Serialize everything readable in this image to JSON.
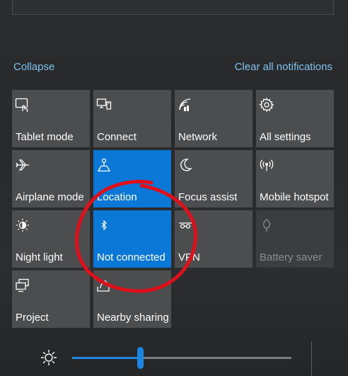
{
  "header": {
    "collapse_label": "Collapse",
    "clear_label": "Clear all notifications"
  },
  "tiles": [
    {
      "label": "Tablet mode",
      "icon": "tablet-mode-icon",
      "state": "off"
    },
    {
      "label": "Connect",
      "icon": "connect-icon",
      "state": "off"
    },
    {
      "label": "Network",
      "icon": "network-icon",
      "state": "off"
    },
    {
      "label": "All settings",
      "icon": "gear-icon",
      "state": "off"
    },
    {
      "label": "Airplane mode",
      "icon": "airplane-icon",
      "state": "off"
    },
    {
      "label": "Location",
      "icon": "location-icon",
      "state": "on"
    },
    {
      "label": "Focus assist",
      "icon": "moon-icon",
      "state": "off"
    },
    {
      "label": "Mobile hotspot",
      "icon": "hotspot-icon",
      "state": "off"
    },
    {
      "label": "Night light",
      "icon": "night-light-icon",
      "state": "off"
    },
    {
      "label": "Not connected",
      "icon": "bluetooth-icon",
      "state": "on"
    },
    {
      "label": "VPN",
      "icon": "vpn-icon",
      "state": "off"
    },
    {
      "label": "Battery saver",
      "icon": "battery-saver-icon",
      "state": "disabled"
    },
    {
      "label": "Project",
      "icon": "project-icon",
      "state": "off"
    },
    {
      "label": "Nearby sharing",
      "icon": "nearby-sharing-icon",
      "state": "off"
    }
  ],
  "brightness": {
    "icon": "brightness-icon",
    "level": 0.31
  },
  "colors": {
    "accent": "#0b78d7",
    "tile": "#4b4d4f",
    "link": "#7ec0ee",
    "annotation": "#e0101a"
  }
}
